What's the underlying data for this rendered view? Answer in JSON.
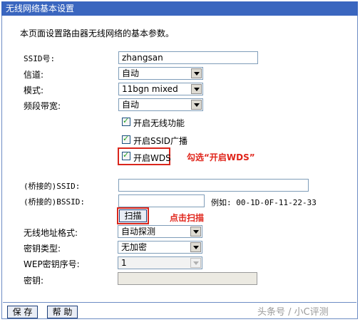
{
  "window": {
    "title": "无线网络基本设置"
  },
  "description": "本页面设置路由器无线网络的基本参数。",
  "form": {
    "ssid": {
      "label": "SSID号:",
      "value": "zhangsan"
    },
    "channel": {
      "label": "信道:",
      "value": "自动"
    },
    "mode": {
      "label": "模式:",
      "value": "11bgn mixed"
    },
    "bandwidth": {
      "label": "频段带宽:",
      "value": "自动"
    },
    "enable_wireless": {
      "label": "开启无线功能",
      "checked": true
    },
    "ssid_broadcast": {
      "label": "开启SSID广播",
      "checked": true
    },
    "enable_wds": {
      "label": "开启WDS",
      "checked": true
    },
    "bridged_ssid": {
      "label": "(桥接的)SSID:",
      "value": ""
    },
    "bridged_bssid": {
      "label": "(桥接的)BSSID:",
      "value": "",
      "example": "例如: 00-1D-0F-11-22-33"
    },
    "scan_button": "扫描",
    "address_format": {
      "label": "无线地址格式:",
      "value": "自动探测"
    },
    "key_type": {
      "label": "密钥类型:",
      "value": "无加密"
    },
    "wep_index": {
      "label": "WEP密钥序号:",
      "value": "1"
    },
    "key": {
      "label": "密钥:",
      "value": ""
    }
  },
  "annotations": {
    "wds": "勾选“开启WDS”",
    "scan": "点击扫描"
  },
  "footer": {
    "save": "保 存",
    "help": "帮 助"
  },
  "watermark": "头条号 / 小C评测",
  "colors": {
    "titlebar": "#3a66bf",
    "annotation": "#e0251b"
  }
}
